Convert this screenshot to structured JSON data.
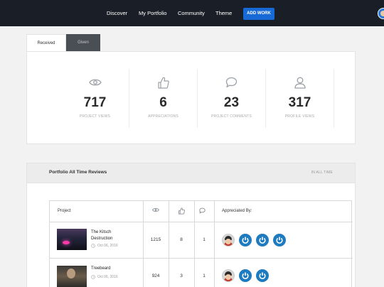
{
  "nav": {
    "links": [
      "Discover",
      "My Portfolio",
      "Community",
      "Theme"
    ],
    "add_work": "ADD WORK",
    "avatar_icon": "user-avatar-icon",
    "background": "#1a1f27",
    "accent": "#1769d6"
  },
  "tabs": [
    {
      "label": "Received",
      "active": true
    },
    {
      "label": "Given",
      "active": false
    }
  ],
  "stats": [
    {
      "icon": "eye-icon",
      "value": "717",
      "label": "PROJECT VIEWS"
    },
    {
      "icon": "thumbs-up-icon",
      "value": "6",
      "label": "APPRECIATIONS"
    },
    {
      "icon": "comment-icon",
      "value": "23",
      "label": "PROJECT COMMENTS"
    },
    {
      "icon": "user-icon",
      "value": "317",
      "label": "PROFILE VIEWS"
    }
  ],
  "reviews": {
    "title": "Portfolio All Time Reviews",
    "range": "IN ALL TIME",
    "columns": {
      "project": "Project",
      "views_icon": "eye-icon",
      "appreciations_icon": "thumbs-up-icon",
      "comments_icon": "comment-icon",
      "appreciated_by": "Appreciated By:"
    },
    "rows": [
      {
        "title_line1": "The Kitsch",
        "title_line2": "Destruction",
        "date": "Oct 06, 2016",
        "views": "1215",
        "appreciations": "8",
        "comments": "1",
        "appreciated_by": [
          "face-avatar",
          "power-avatar",
          "power-avatar",
          "power-avatar"
        ]
      },
      {
        "title_line1": "Treebeard",
        "title_line2": "",
        "date": "Oct 06, 2016",
        "views": "924",
        "appreciations": "3",
        "comments": "1",
        "appreciated_by": [
          "face-avatar",
          "power-avatar",
          "power-avatar"
        ]
      }
    ]
  }
}
